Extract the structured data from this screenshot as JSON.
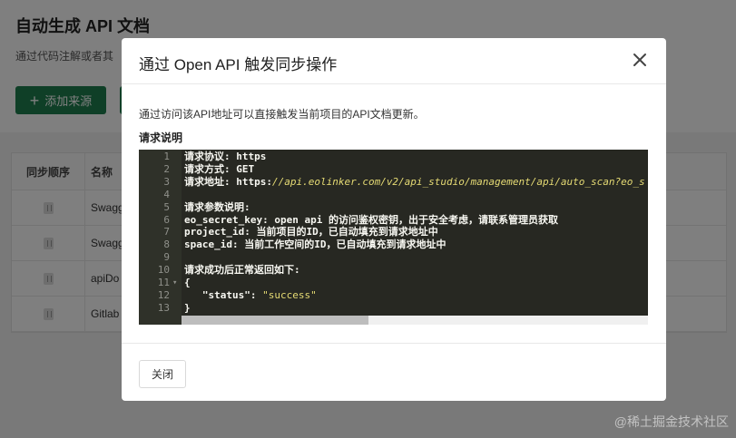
{
  "background": {
    "title": "自动生成 API 文档",
    "description": "通过代码注解或者其",
    "add_source_label": "添加来源",
    "table": {
      "headers": [
        "同步顺序",
        "名称"
      ],
      "rows": [
        "Swagg",
        "Swagg",
        "apiDo",
        "Gitlab"
      ]
    }
  },
  "modal": {
    "title": "通过 Open API 触发同步操作",
    "intro": "通过访问该API地址可以直接触发当前项目的API文档更新。",
    "section_title": "请求说明",
    "code_lines": [
      {
        "n": "1",
        "text": "请求协议: https"
      },
      {
        "n": "2",
        "text": "请求方式: GET"
      },
      {
        "n": "3",
        "prefix": "请求地址: https:",
        "url": "//api.eolinker.com/v2/api_studio/management/api/auto_scan?eo_s"
      },
      {
        "n": "4",
        "text": ""
      },
      {
        "n": "5",
        "text": "请求参数说明:"
      },
      {
        "n": "6",
        "text": "eo_secret_key: open api 的访问鉴权密钥，出于安全考虑，请联系管理员获取"
      },
      {
        "n": "7",
        "text": "project_id: 当前项目的ID，已自动填充到请求地址中"
      },
      {
        "n": "8",
        "text": "space_id: 当前工作空间的ID，已自动填充到请求地址中"
      },
      {
        "n": "9",
        "text": ""
      },
      {
        "n": "10",
        "text": "请求成功后正常返回如下:"
      },
      {
        "n": "11",
        "text": "{",
        "fold": true
      },
      {
        "n": "12",
        "key": "   \"status\"",
        "sep": ": ",
        "value": "\"success\""
      },
      {
        "n": "13",
        "text": "}"
      }
    ],
    "close_label": "关闭"
  },
  "watermark": "@稀土掘金技术社区"
}
